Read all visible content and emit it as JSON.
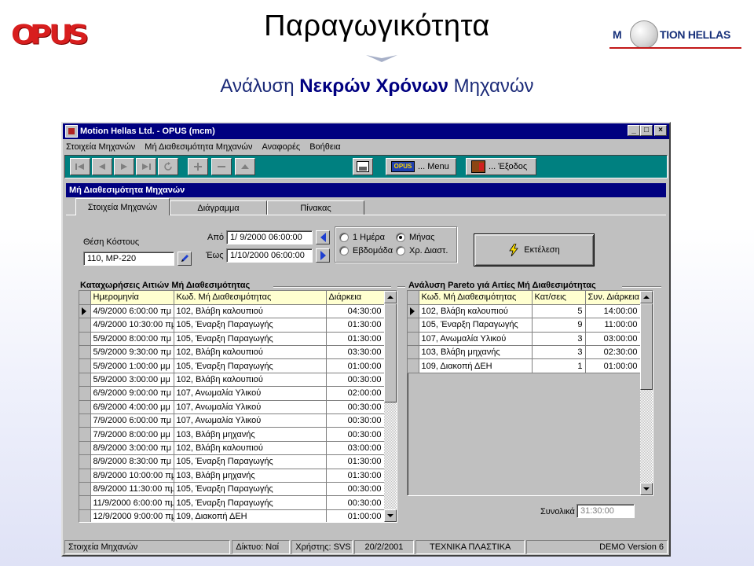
{
  "slide": {
    "title": "Παραγωγικότητα",
    "subtitle_plain_1": "Ανάλυση ",
    "subtitle_bold": "Νεκρών Χρόνων",
    "subtitle_plain_2": " Μηχανών",
    "logo_left_letters": [
      "O",
      "P",
      "U",
      "S"
    ],
    "logo_right_m": "M",
    "logo_right_rest": "TION HELLAS",
    "colors": {
      "opus_red": "#d81e1e",
      "title_blue": "#000080",
      "toolbar_teal": "#008080"
    }
  },
  "window": {
    "title": "Motion Hellas Ltd. - OPUS (mcm)",
    "buttons": {
      "minimize": "_",
      "maximize": "□",
      "close": "×"
    },
    "menu": [
      "Στοιχεία Μηχανών",
      "Μή Διαθεσιμότητα Μηχανών",
      "Αναφορές",
      "Βοήθεια"
    ],
    "toolbar": {
      "nav_icons": [
        "first-record-icon",
        "prev-record-icon",
        "next-record-icon",
        "last-record-icon",
        "refresh-icon",
        "add-record-icon",
        "delete-record-icon",
        "up-icon"
      ],
      "menu_button": "... Menu",
      "exit_button": "... Έξοδος",
      "opus_badge": "OPUS"
    }
  },
  "form": {
    "title": "Μή Διαθεσιμότητα Μηχανών",
    "tabs": [
      "Στοιχεία Μηχανών",
      "Διάγραμμα",
      "Πίνακας"
    ],
    "cost_center_label": "Θέση Κόστους",
    "cost_center_value": "110, MP-220",
    "from_label": "Από",
    "to_label": "Έως",
    "from_value": "1/ 9/2000 06:00:00",
    "to_value": "1/10/2000 06:00:00",
    "periods": [
      {
        "label": "1 Ημέρα",
        "checked": false
      },
      {
        "label": "Μήνας",
        "checked": true
      },
      {
        "label": "Εβδομάδα",
        "checked": false
      },
      {
        "label": "Χρ. Διαστ.",
        "checked": false
      }
    ],
    "execute_label": "Εκτέλεση",
    "left_section_title": "Καταχωρήσεις Αιτιών Μή Διαθεσιμότητας",
    "right_section_title": "Ανάλυση Pareto γιά Αιτίες Μή Διαθεσιμότητας",
    "entries": {
      "headers": [
        "Ημερομηνία",
        "Κωδ. Μή Διαθεσιμότητας",
        "Διάρκεια"
      ],
      "rows": [
        [
          "4/9/2000 6:00:00 πμ",
          "102, Βλάβη καλουπιού",
          "04:30:00"
        ],
        [
          "4/9/2000 10:30:00 πμ",
          "105, Έναρξη Παραγωγής",
          "01:30:00"
        ],
        [
          "5/9/2000 8:00:00 πμ",
          "105, Έναρξη Παραγωγής",
          "01:30:00"
        ],
        [
          "5/9/2000 9:30:00 πμ",
          "102, Βλάβη καλουπιού",
          "03:30:00"
        ],
        [
          "5/9/2000 1:00:00 μμ",
          "105, Έναρξη Παραγωγής",
          "01:00:00"
        ],
        [
          "5/9/2000 3:00:00 μμ",
          "102, Βλάβη καλουπιού",
          "00:30:00"
        ],
        [
          "6/9/2000 9:00:00 πμ",
          "107, Ανωμαλία Υλικού",
          "02:00:00"
        ],
        [
          "6/9/2000 4:00:00 μμ",
          "107, Ανωμαλία Υλικού",
          "00:30:00"
        ],
        [
          "7/9/2000 6:00:00 πμ",
          "107, Ανωμαλία Υλικού",
          "00:30:00"
        ],
        [
          "7/9/2000 8:00:00 μμ",
          "103, Βλάβη μηχανής",
          "00:30:00"
        ],
        [
          "8/9/2000 3:00:00 πμ",
          "102, Βλάβη καλουπιού",
          "03:00:00"
        ],
        [
          "8/9/2000 8:30:00 πμ",
          "105, Έναρξη Παραγωγής",
          "01:30:00"
        ],
        [
          "8/9/2000 10:00:00 πμ",
          "103, Βλάβη μηχανής",
          "01:30:00"
        ],
        [
          "8/9/2000 11:30:00 πμ",
          "105, Έναρξη Παραγωγής",
          "00:30:00"
        ],
        [
          "11/9/2000 6:00:00 πμ",
          "105, Έναρξη Παραγωγής",
          "00:30:00"
        ],
        [
          "12/9/2000 9:00:00 πμ",
          "109, Διακοπή ΔΕΗ",
          "01:00:00"
        ]
      ]
    },
    "pareto": {
      "headers": [
        "Κωδ. Μή Διαθεσιμότητας",
        "Κατ/σεις",
        "Συν. Διάρκεια"
      ],
      "rows": [
        [
          "102, Βλάβη καλουπιού",
          "5",
          "14:00:00"
        ],
        [
          "105, Έναρξη Παραγωγής",
          "9",
          "11:00:00"
        ],
        [
          "107, Ανωμαλία Υλικού",
          "3",
          "03:00:00"
        ],
        [
          "103, Βλάβη μηχανής",
          "3",
          "02:30:00"
        ],
        [
          "109, Διακοπή ΔΕΗ",
          "1",
          "01:00:00"
        ]
      ]
    },
    "total_label": "Συνολικά",
    "total_value": "31:30:00"
  },
  "statusbar": [
    "Στοιχεία Μηχανών",
    "Δίκτυο: Ναί",
    "Χρήστης: SVS",
    "20/2/2001",
    "ΤΕΧΝΙΚΑ ΠΛΑΣΤΙΚΑ",
    "DEMO Version 6"
  ]
}
